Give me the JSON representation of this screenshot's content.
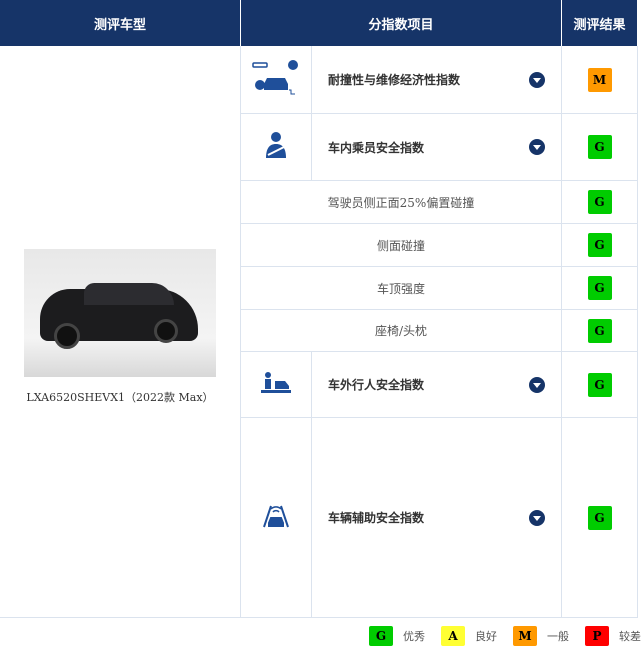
{
  "header": {
    "col1": "测评车型",
    "col2": "分指数项目",
    "col3": "测评结果"
  },
  "vehicle": {
    "name": "LXA6520SHEVX1（2022款 Max）"
  },
  "rows": [
    {
      "label": "耐撞性与维修经济性指数",
      "result": "M",
      "icon": "crash-repair-icon",
      "expandable": true
    },
    {
      "label": "车内乘员安全指数",
      "result": "G",
      "icon": "occupant-seatbelt-icon",
      "expandable": true
    },
    {
      "label": "驾驶员侧正面25%偏置碰撞",
      "result": "G",
      "sub": true
    },
    {
      "label": "侧面碰撞",
      "result": "G",
      "sub": true
    },
    {
      "label": "车顶强度",
      "result": "G",
      "sub": true
    },
    {
      "label": "座椅/头枕",
      "result": "G",
      "sub": true
    },
    {
      "label": "车外行人安全指数",
      "result": "G",
      "icon": "pedestrian-icon",
      "expandable": true
    },
    {
      "label": "车辆辅助安全指数",
      "result": "G",
      "icon": "driver-assist-icon",
      "expandable": true
    }
  ],
  "legend": [
    {
      "grade": "G",
      "text": "优秀"
    },
    {
      "grade": "A",
      "text": "良好"
    },
    {
      "grade": "M",
      "text": "一般"
    },
    {
      "grade": "P",
      "text": "较差"
    }
  ],
  "colors": {
    "G": "#00cc00",
    "A": "#ffff33",
    "M": "#ff9900",
    "P": "#ff0000",
    "navy": "#163468"
  }
}
